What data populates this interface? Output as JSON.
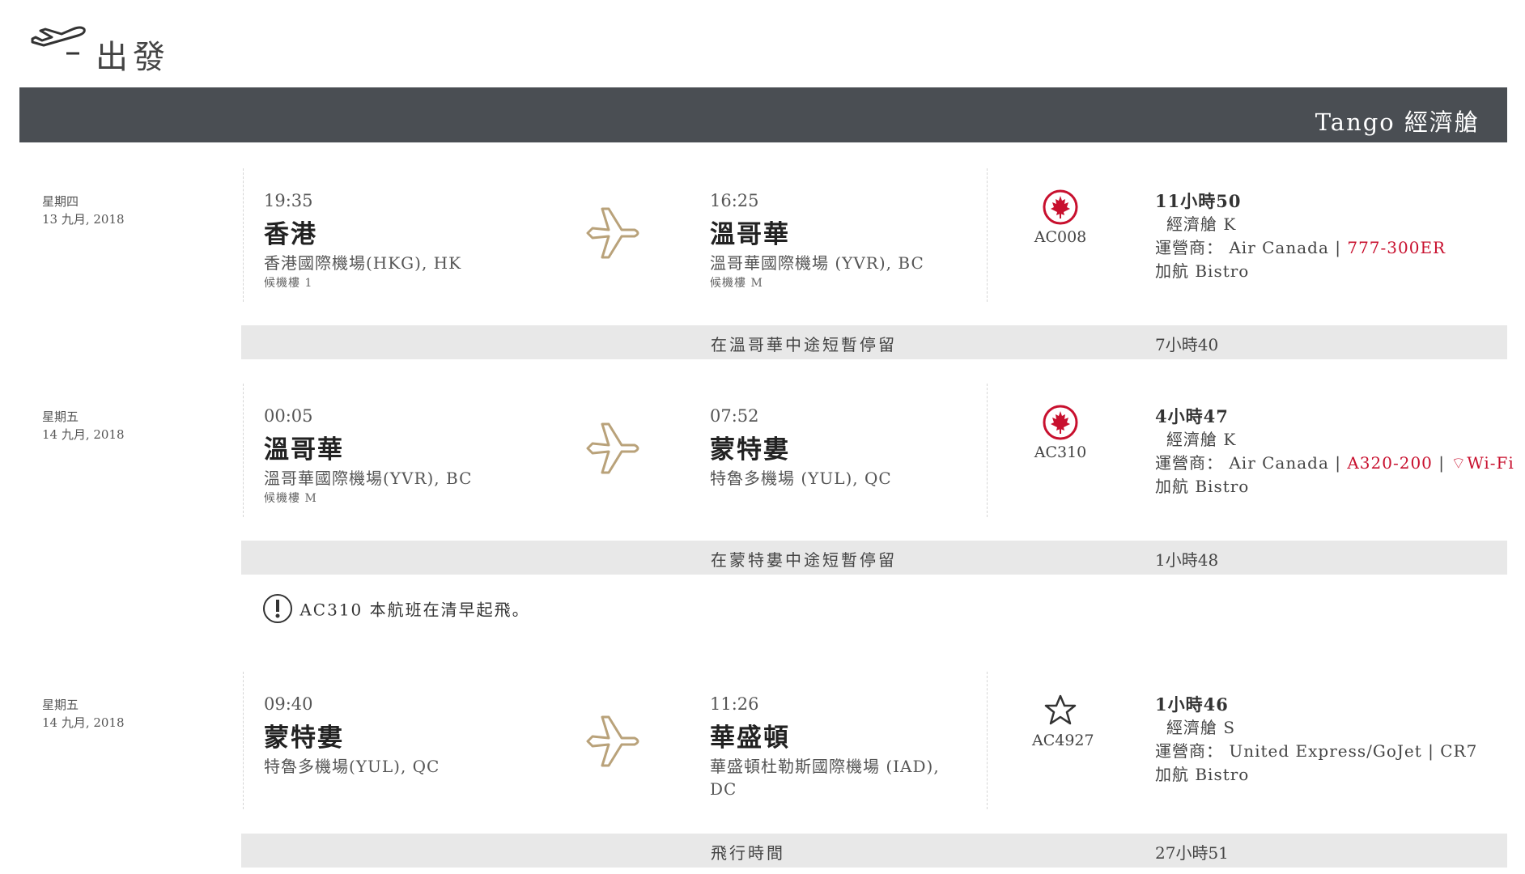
{
  "header": {
    "title": "出發",
    "icon": "plane-takeoff-icon"
  },
  "cabin_band": {
    "label": "Tango 經濟艙"
  },
  "segments": [
    {
      "date_line1": "星期四",
      "date_line2": "13 九月, 2018",
      "dep": {
        "time": "19:35",
        "city": "香港",
        "airport": "香港國際機場(HKG), HK",
        "terminal": "候機樓 1"
      },
      "arr": {
        "time": "16:25",
        "city": "溫哥華",
        "airport": "溫哥華國際機場 (YVR), BC",
        "terminal": "候機樓 M"
      },
      "airline_logo": "air-canada-maple-leaf-icon",
      "flight_no": "AC008",
      "duration": "11小時50",
      "cabin": "經濟艙 K",
      "operator_label": "運營商：",
      "operator": "Air Canada",
      "sep": "|",
      "aircraft": "777-300ER",
      "meal": "加航 Bistro"
    },
    {
      "date_line1": "星期五",
      "date_line2": "14 九月, 2018",
      "dep": {
        "time": "00:05",
        "city": "溫哥華",
        "airport": "溫哥華國際機場(YVR), BC",
        "terminal": "候機樓 M"
      },
      "arr": {
        "time": "07:52",
        "city": "蒙特婁",
        "airport": "特魯多機場 (YUL), QC"
      },
      "airline_logo": "air-canada-maple-leaf-icon",
      "flight_no": "AC310",
      "duration": "4小時47",
      "cabin": "經濟艙 K",
      "operator_label": "運營商：",
      "operator": "Air Canada",
      "sep": "|",
      "aircraft": "A320-200",
      "sep2": "|",
      "wifi": "Wi-Fi",
      "meal": "加航 Bistro"
    },
    {
      "date_line1": "星期五",
      "date_line2": "14 九月, 2018",
      "dep": {
        "time": "09:40",
        "city": "蒙特婁",
        "airport": "特魯多機場(YUL), QC"
      },
      "arr": {
        "time": "11:26",
        "city": "華盛頓",
        "airport": "華盛頓杜勒斯國際機場 (IAD), DC"
      },
      "airline_logo": "star-alliance-icon",
      "flight_no": "AC4927",
      "duration": "1小時46",
      "cabin": "經濟艙 S",
      "operator_label": "運營商：",
      "operator": "United Express/GoJet",
      "sep": "|",
      "aircraft": "CR7",
      "meal": "加航 Bistro"
    }
  ],
  "layovers": [
    {
      "label": "在溫哥華中途短暫停留",
      "duration": "7小時40"
    },
    {
      "label": "在蒙特婁中途短暫停留",
      "duration": "1小時48"
    }
  ],
  "notice": {
    "text": "AC310 本航班在清早起飛。"
  },
  "total": {
    "label": "飛行時間",
    "duration": "27小時51"
  },
  "colors": {
    "band": "#4a4e53",
    "accent_red": "#c8102e",
    "bar": "#e8e8e8",
    "plane_gold": "#b9a27a"
  }
}
